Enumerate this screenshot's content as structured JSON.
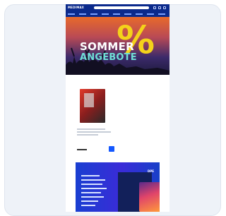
{
  "header": {
    "logo_text": "MEDIMAX",
    "search_placeholder": "",
    "nav_items": [
      "",
      "",
      "",
      "",
      "",
      "",
      "",
      "",
      ""
    ]
  },
  "hero": {
    "title_line1": "SOMMER",
    "title_line2": "ANGEBOTE",
    "percent_symbol": "%"
  },
  "product": {
    "price": ""
  },
  "promo": {
    "tag": "DPE"
  },
  "colors": {
    "header_bg": "#0b2a8c",
    "accent_yellow": "#f4d21a",
    "accent_cyan": "#6fe0d6",
    "cart_button": "#1458ff",
    "promo_bg": "#1a3fd1"
  }
}
